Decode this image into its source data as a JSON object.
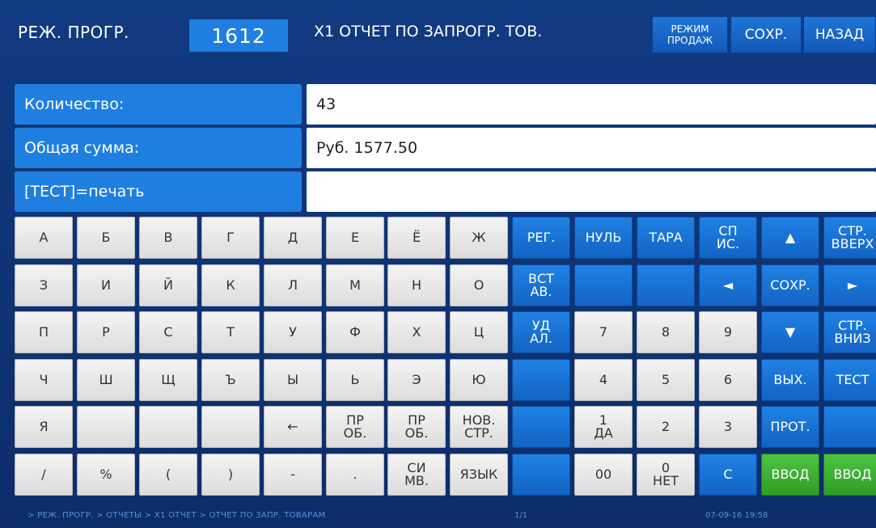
{
  "header": {
    "title": "РЕЖ. ПРОГР.",
    "code": "1612",
    "subtitle": "X1 ОТЧЕТ ПО ЗАПРОГР. ТОВ.",
    "mode_label": "РЕЖИМ\nПРОДАЖ",
    "save_label": "СОХР.",
    "back_label": "НАЗАД"
  },
  "fields": [
    {
      "label": "Количество:",
      "value": "43"
    },
    {
      "label": "Общая сумма:",
      "value": "Руб. 1577.50"
    },
    {
      "label": "[ТЕСТ]=печать",
      "value": ""
    }
  ],
  "keyboard": {
    "rows": [
      [
        {
          "label": "А",
          "style": "light"
        },
        {
          "label": "Б",
          "style": "light"
        },
        {
          "label": "В",
          "style": "light"
        },
        {
          "label": "Г",
          "style": "light"
        },
        {
          "label": "Д",
          "style": "light"
        },
        {
          "label": "Е",
          "style": "light"
        },
        {
          "label": "Ё",
          "style": "light"
        },
        {
          "label": "Ж",
          "style": "light"
        },
        {
          "label": "РЕГ.",
          "style": "blue"
        },
        {
          "label": "НУЛЬ",
          "style": "blue"
        },
        {
          "label": "ТАРА",
          "style": "blue"
        },
        {
          "label": "СП\nИС.",
          "style": "blue"
        },
        {
          "label": "▲",
          "style": "blue"
        },
        {
          "label": "СТР.\nВВЕРХ",
          "style": "blue"
        }
      ],
      [
        {
          "label": "З",
          "style": "light"
        },
        {
          "label": "И",
          "style": "light"
        },
        {
          "label": "Й",
          "style": "light"
        },
        {
          "label": "К",
          "style": "light"
        },
        {
          "label": "Л",
          "style": "light"
        },
        {
          "label": "М",
          "style": "light"
        },
        {
          "label": "Н",
          "style": "light"
        },
        {
          "label": "О",
          "style": "light"
        },
        {
          "label": "ВСТ\nАВ.",
          "style": "blue"
        },
        {
          "label": "",
          "style": "blue"
        },
        {
          "label": "",
          "style": "blue"
        },
        {
          "label": "◄",
          "style": "blue"
        },
        {
          "label": "СОХР.",
          "style": "blue"
        },
        {
          "label": "►",
          "style": "blue"
        }
      ],
      [
        {
          "label": "П",
          "style": "light"
        },
        {
          "label": "Р",
          "style": "light"
        },
        {
          "label": "С",
          "style": "light"
        },
        {
          "label": "Т",
          "style": "light"
        },
        {
          "label": "У",
          "style": "light"
        },
        {
          "label": "Ф",
          "style": "light"
        },
        {
          "label": "Х",
          "style": "light"
        },
        {
          "label": "Ц",
          "style": "light"
        },
        {
          "label": "УД\nАЛ.",
          "style": "blue"
        },
        {
          "label": "7",
          "style": "light"
        },
        {
          "label": "8",
          "style": "light"
        },
        {
          "label": "9",
          "style": "light"
        },
        {
          "label": "▼",
          "style": "blue"
        },
        {
          "label": "СТР.\nВНИЗ",
          "style": "blue"
        }
      ],
      [
        {
          "label": "Ч",
          "style": "light"
        },
        {
          "label": "Ш",
          "style": "light"
        },
        {
          "label": "Щ",
          "style": "light"
        },
        {
          "label": "Ъ",
          "style": "light"
        },
        {
          "label": "Ы",
          "style": "light"
        },
        {
          "label": "Ь",
          "style": "light"
        },
        {
          "label": "Э",
          "style": "light"
        },
        {
          "label": "Ю",
          "style": "light"
        },
        {
          "label": "",
          "style": "blue"
        },
        {
          "label": "4",
          "style": "light"
        },
        {
          "label": "5",
          "style": "light"
        },
        {
          "label": "6",
          "style": "light"
        },
        {
          "label": "ВЫХ.",
          "style": "blue"
        },
        {
          "label": "ТЕСТ",
          "style": "blue"
        }
      ],
      [
        {
          "label": "Я",
          "style": "light"
        },
        {
          "label": "",
          "style": "light"
        },
        {
          "label": "",
          "style": "light"
        },
        {
          "label": "",
          "style": "light"
        },
        {
          "label": "←",
          "style": "light"
        },
        {
          "label": "ПР\nОБ.",
          "style": "light"
        },
        {
          "label": "ПР\nОБ.",
          "style": "light"
        },
        {
          "label": "НОВ.\nСТР.",
          "style": "light"
        },
        {
          "label": "",
          "style": "blue"
        },
        {
          "label": "1\nДА",
          "style": "light"
        },
        {
          "label": "2",
          "style": "light"
        },
        {
          "label": "3",
          "style": "light"
        },
        {
          "label": "ПРОТ.",
          "style": "blue"
        },
        {
          "label": "",
          "style": "blue"
        }
      ],
      [
        {
          "label": "/",
          "style": "light"
        },
        {
          "label": "%",
          "style": "light"
        },
        {
          "label": "(",
          "style": "light"
        },
        {
          "label": ")",
          "style": "light"
        },
        {
          "label": "-",
          "style": "light"
        },
        {
          "label": ".",
          "style": "light"
        },
        {
          "label": "СИ\nМВ.",
          "style": "light"
        },
        {
          "label": "ЯЗЫК",
          "style": "light"
        },
        {
          "label": "",
          "style": "blue"
        },
        {
          "label": "00",
          "style": "light"
        },
        {
          "label": "0\nНЕТ",
          "style": "light"
        },
        {
          "label": "С",
          "style": "blue"
        },
        {
          "label": "ВВОД",
          "style": "green"
        },
        {
          "label": "ВВОД",
          "style": "green"
        }
      ]
    ]
  },
  "footer": {
    "path": "> РЕЖ. ПРОГР. > ОТЧЕТЫ > X1 ОТЧЕТ > ОТЧЕТ ПО ЗАПР. ТОВАРАМ",
    "page": "1/1",
    "datetime": "07-09-16 19:58"
  },
  "colors": {
    "background": "#0c2d6a",
    "accent_blue": "#1f7fe0",
    "green": "#3fb035",
    "light_key": "#e8e8e8"
  }
}
